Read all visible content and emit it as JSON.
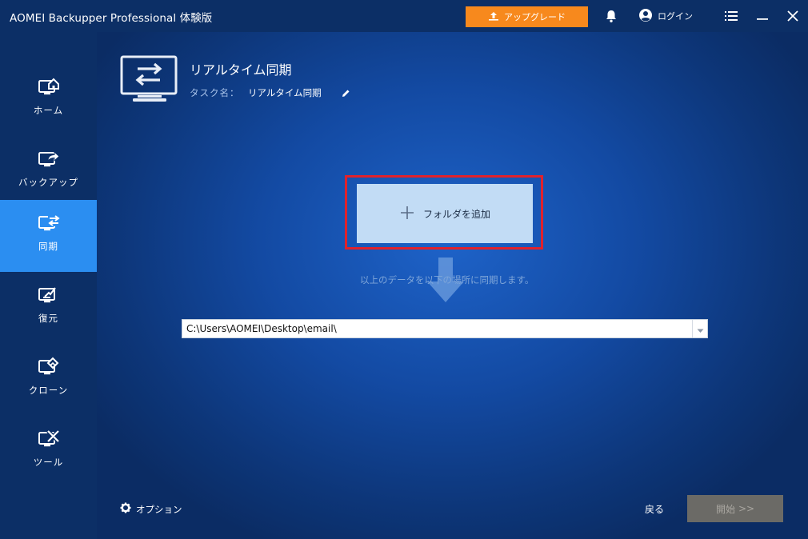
{
  "window": {
    "title": "AOMEI Backupper Professional 体験版"
  },
  "titlebar": {
    "upgrade_label": "アップグレード",
    "login_label": "ログイン",
    "icons": [
      "bell-icon",
      "user-icon",
      "menu-icon",
      "minimize-icon",
      "close-icon"
    ]
  },
  "sidebar": {
    "items": [
      {
        "label": "ホーム",
        "icon": "home-icon",
        "active": false
      },
      {
        "label": "バックアップ",
        "icon": "backup-icon",
        "active": false
      },
      {
        "label": "同期",
        "icon": "sync-icon",
        "active": true
      },
      {
        "label": "復元",
        "icon": "restore-icon",
        "active": false
      },
      {
        "label": "クローン",
        "icon": "clone-icon",
        "active": false
      },
      {
        "label": "ツール",
        "icon": "tools-icon",
        "active": false
      }
    ]
  },
  "header": {
    "title": "リアルタイム同期",
    "task_label": "タスク名：",
    "task_name": "リアルタイム同期"
  },
  "main": {
    "add_folder_label": "フォルダを追加",
    "hint": "以上のデータを以下の場所に同期します。",
    "destination_path": "C:\\Users\\AOMEI\\Desktop\\email\\"
  },
  "footer": {
    "options_label": "オプション",
    "back_label": "戻る",
    "start_label": "開始",
    "start_chevrons": ">>"
  },
  "colors": {
    "accent": "#2b8ef1",
    "upgrade": "#f7891d",
    "highlight": "#e0222c",
    "sidebar_bg": "#0c2f66"
  }
}
